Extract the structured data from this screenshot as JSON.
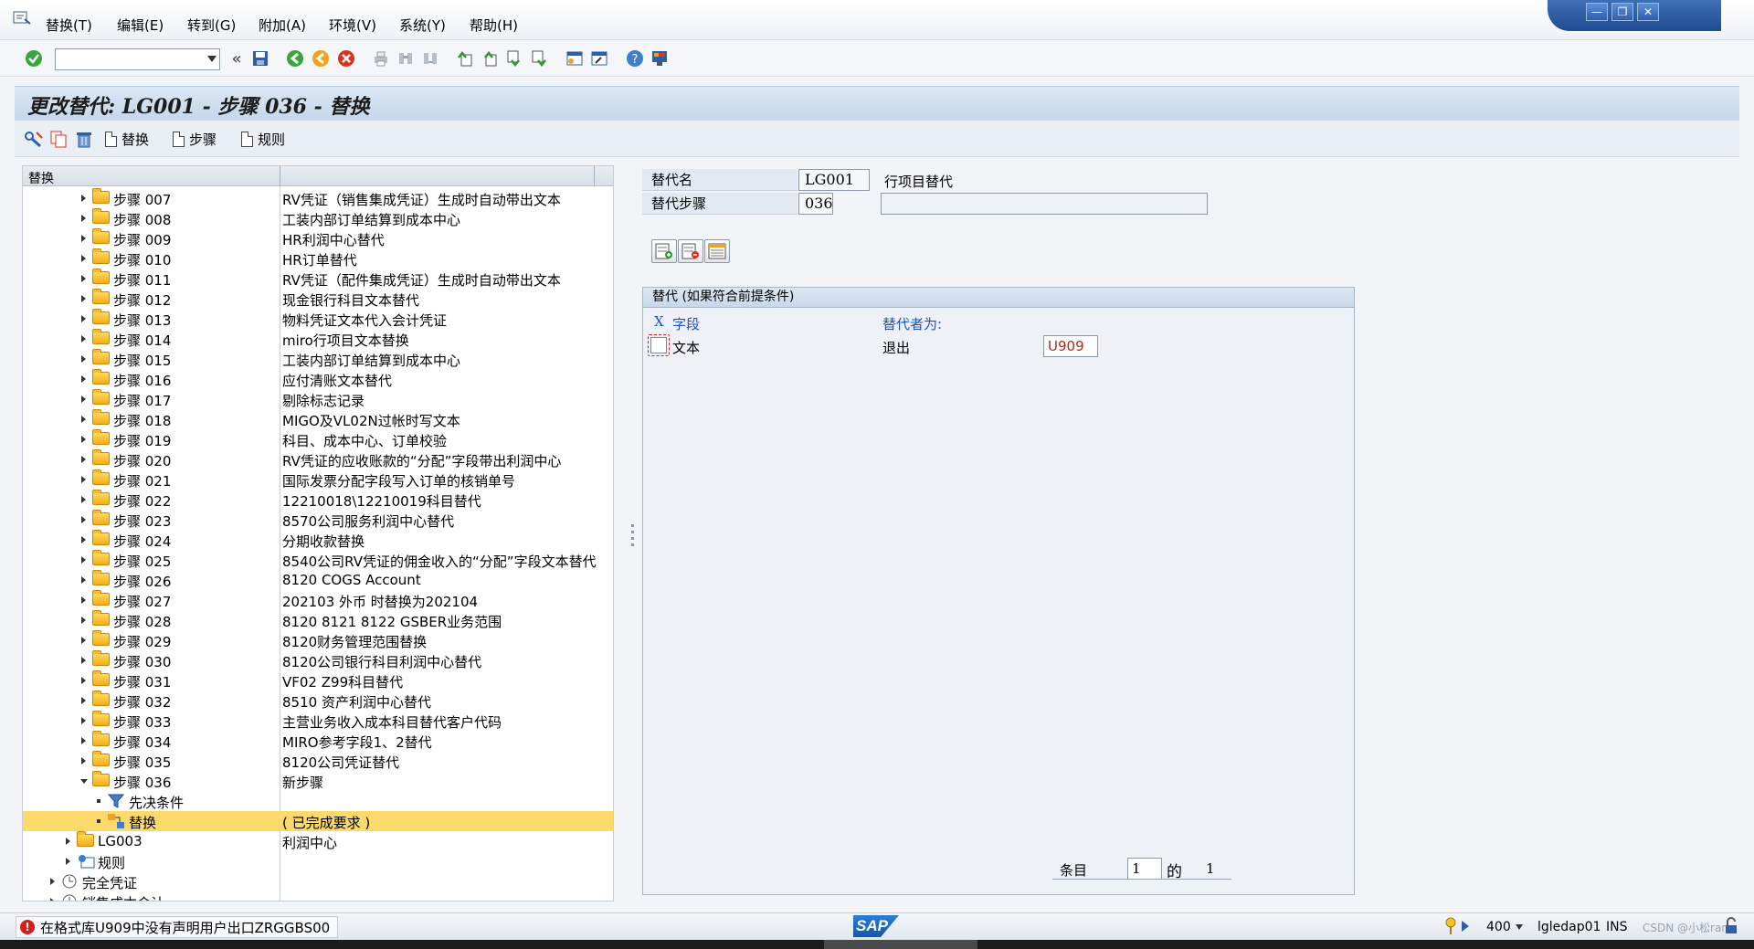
{
  "menu": {
    "items": [
      "替换(T)",
      "编辑(E)",
      "转到(G)",
      "附加(A)",
      "环境(V)",
      "系统(Y)",
      "帮助(H)"
    ]
  },
  "window_controls": {
    "minimize": "—",
    "restore": "❐",
    "close": "✕"
  },
  "toolbar": {
    "command_field_value": "",
    "icons": [
      "enter-icon",
      "back-double-icon",
      "save-icon",
      "back-icon",
      "exit-icon",
      "cancel-icon",
      "print-icon",
      "find-icon",
      "find-next-icon",
      "first-page-icon",
      "prev-page-icon",
      "next-page-icon",
      "last-page-icon",
      "new-session-icon",
      "shortcut-icon",
      "help-icon",
      "settings-icon"
    ]
  },
  "title": "更改替代: LG001 - 步骤 036 - 替换",
  "app_toolbar": {
    "substitution_label": "替换",
    "step_label": "步骤",
    "rule_label": "规则"
  },
  "tree": {
    "header": "替换",
    "steps": [
      {
        "label": "步骤 007",
        "desc": "RV凭证（销售集成凭证）生成时自动带出文本"
      },
      {
        "label": "步骤 008",
        "desc": "工装内部订单结算到成本中心"
      },
      {
        "label": "步骤 009",
        "desc": "HR利润中心替代"
      },
      {
        "label": "步骤 010",
        "desc": "HR订单替代"
      },
      {
        "label": "步骤 011",
        "desc": "RV凭证（配件集成凭证）生成时自动带出文本"
      },
      {
        "label": "步骤 012",
        "desc": "现金银行科目文本替代"
      },
      {
        "label": "步骤 013",
        "desc": "物料凭证文本代入会计凭证"
      },
      {
        "label": "步骤 014",
        "desc": "miro行项目文本替换"
      },
      {
        "label": "步骤 015",
        "desc": "工装内部订单结算到成本中心"
      },
      {
        "label": "步骤 016",
        "desc": "应付清账文本替代"
      },
      {
        "label": "步骤 017",
        "desc": "剔除标志记录"
      },
      {
        "label": "步骤 018",
        "desc": "MIGO及VL02N过帐时写文本"
      },
      {
        "label": "步骤 019",
        "desc": "科目、成本中心、订单校验"
      },
      {
        "label": "步骤 020",
        "desc": "RV凭证的应收账款的“分配”字段带出利润中心"
      },
      {
        "label": "步骤 021",
        "desc": "国际发票分配字段写入订单的核销单号"
      },
      {
        "label": "步骤 022",
        "desc": "12210018\\12210019科目替代"
      },
      {
        "label": "步骤 023",
        "desc": "8570公司服务利润中心替代"
      },
      {
        "label": "步骤 024",
        "desc": "分期收款替换"
      },
      {
        "label": "步骤 025",
        "desc": "8540公司RV凭证的佣金收入的“分配”字段文本替代"
      },
      {
        "label": "步骤 026",
        "desc": "8120 COGS Account"
      },
      {
        "label": "步骤 027",
        "desc": "202103 外币 时替换为202104"
      },
      {
        "label": "步骤 028",
        "desc": "8120 8121 8122 GSBER业务范围"
      },
      {
        "label": "步骤 029",
        "desc": "8120财务管理范围替换"
      },
      {
        "label": "步骤 030",
        "desc": "8120公司银行科目利润中心替代"
      },
      {
        "label": "步骤 031",
        "desc": "VF02 Z99科目替代"
      },
      {
        "label": "步骤 032",
        "desc": "8510 资产利润中心替代"
      },
      {
        "label": "步骤 033",
        "desc": "主营业务收入成本科目替代客户代码"
      },
      {
        "label": "步骤 034",
        "desc": "MIRO参考字段1、2替代"
      },
      {
        "label": "步骤 035",
        "desc": "8120公司凭证替代"
      }
    ],
    "open_step": {
      "label": "步骤 036",
      "desc": "新步骤"
    },
    "prerequisite": {
      "label": "先决条件"
    },
    "substitution": {
      "label": "替换",
      "desc": "( 已完成要求 )"
    },
    "lg003": {
      "label": "LG003",
      "desc": "利润中心"
    },
    "rules": {
      "label": "规则"
    },
    "complete_doc": {
      "label": "完全凭证"
    },
    "cut_item": {
      "label": "销售成本会计"
    }
  },
  "detail": {
    "subst_name_label": "替代名",
    "subst_name_value": "LG001",
    "subst_name_desc": "行项目替代",
    "subst_step_label": "替代步骤",
    "subst_step_value": "036",
    "subst_step_desc": ""
  },
  "subst_group": {
    "title": "替代 (如果符合前提条件)",
    "x_label": "X",
    "field_header": "字段",
    "replaced_by_header": "替代者为:",
    "row_field": "文本",
    "row_type": "退出",
    "row_value": "U909",
    "entry_label": "条目",
    "entry_current": "1",
    "of_label": "的",
    "entry_total": "1"
  },
  "status": {
    "message": "在格式库U909中没有声明用户出口ZRGGBS00",
    "sap_logo": "SAP",
    "client": "400",
    "server": "lgledap01",
    "mode": "INS",
    "watermark": "CSDN @小松ran"
  },
  "colors": {
    "selected_row": "#fbd96b",
    "title_bg": "#c5d7ea",
    "blue_text": "#1e4fc2",
    "error_red": "#d42018"
  }
}
